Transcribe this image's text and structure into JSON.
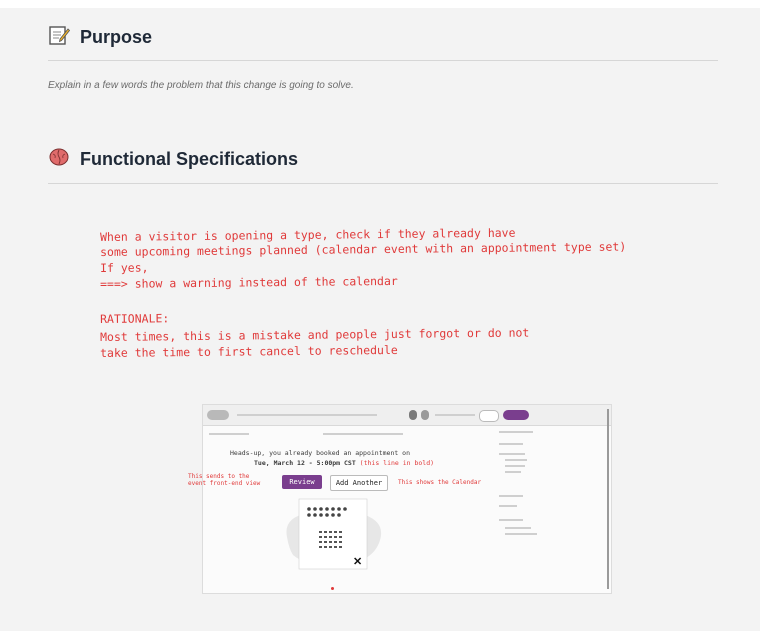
{
  "purpose": {
    "title": "Purpose",
    "hint": "Explain in a few words the problem that this change is going to solve."
  },
  "functional": {
    "title": "Functional Specifications",
    "annotation": [
      "When a visitor is opening a type, check if they already have",
      "some upcoming meetings planned (calendar event with an appointment type set)",
      "If yes,",
      "===> show a warning instead of the calendar"
    ],
    "rationale_label": "RATIONALE:",
    "rationale": [
      "Most times, this is a mistake and people just forgot or do not",
      "take the time to first cancel to reschedule"
    ]
  },
  "mockup": {
    "notice_line1": "Heads-up, you already booked an appointment on",
    "notice_line2": "Tue, March 12 - 5:00pm CST",
    "notice_bold_hint": "(this line in bold)",
    "review_button": "Review",
    "add_another_button": "Add Another",
    "left_note": "This sends to the\nevent front-end view",
    "right_note": "This shows the Calendar",
    "close_mark": "✕"
  },
  "colors": {
    "accent": "#e03a3a",
    "button_purple": "#7a3e8e",
    "brain_icon": "#e06b6b"
  }
}
